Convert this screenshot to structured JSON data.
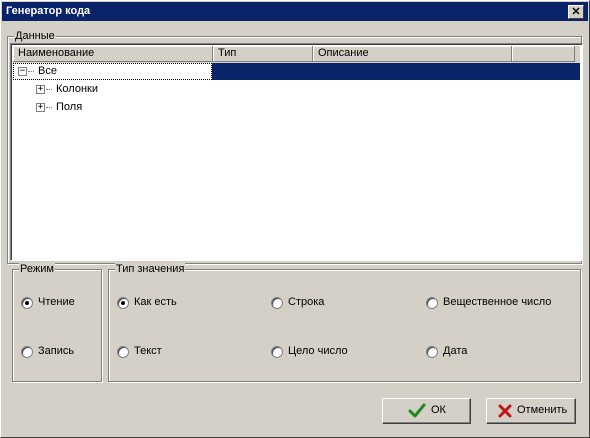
{
  "window": {
    "title": "Генератор кода",
    "close_glyph": "✕"
  },
  "data_group": {
    "label": "Данные",
    "columns": [
      "Наименование",
      "Тип",
      "Описание"
    ],
    "rows": [
      {
        "name": "Все",
        "expander": "−",
        "type": "",
        "description": ""
      },
      {
        "name": "Колонки",
        "expander": "+",
        "type": "",
        "description": ""
      },
      {
        "name": "Поля",
        "expander": "+",
        "type": "",
        "description": ""
      }
    ]
  },
  "mode_group": {
    "label": "Режим",
    "options": [
      {
        "label": "Чтение",
        "checked": true
      },
      {
        "label": "Запись",
        "checked": false
      }
    ]
  },
  "value_type_group": {
    "label": "Тип значения",
    "options": [
      {
        "label": "Как есть",
        "checked": true
      },
      {
        "label": "Строка",
        "checked": false
      },
      {
        "label": "Вещественное число",
        "checked": false
      },
      {
        "label": "Текст",
        "checked": false
      },
      {
        "label": "Цело число",
        "checked": false
      },
      {
        "label": "Дата",
        "checked": false
      }
    ]
  },
  "buttons": {
    "ok": {
      "label": "ОК",
      "icon": "checkmark-icon"
    },
    "cancel": {
      "label": "Отменить",
      "icon": "x-cross-icon"
    }
  },
  "colors": {
    "titlebar": "#0a246a",
    "selection": "#0a246a",
    "face": "#d4d0c8",
    "ok_check": "#1e8c1e",
    "cancel_x": "#c01818"
  }
}
